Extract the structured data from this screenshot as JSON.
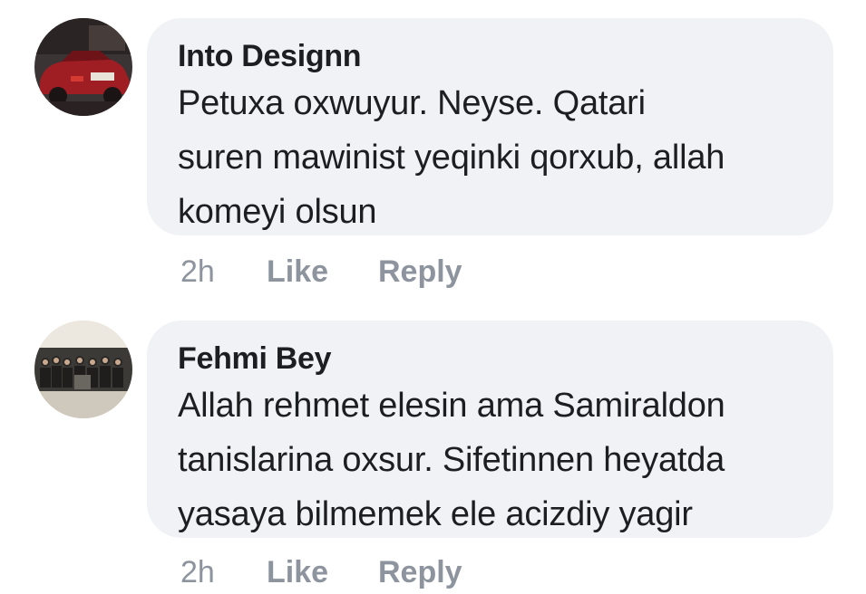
{
  "comments": [
    {
      "author": "Into Designn",
      "text": "Petuxa oxwuyur. Neyse. Qatari suren mawinist yeqinki qorxub, allah komeyi olsun",
      "text_lines": [
        "Petuxa oxwuyur. Neyse. Qatari",
        "suren mawinist yeqinki qorxub, allah",
        "komeyi olsun"
      ],
      "time": "2h",
      "like_label": "Like",
      "reply_label": "Reply",
      "avatar_icon": "profile-photo-car"
    },
    {
      "author": "Fehmi Bey",
      "text": "Allah rehmet elesin ama Samiraldon tanislarina oxsur. Sifetinnen heyatda yasaya bilmemek ele acizdiy yagir",
      "text_lines": [
        "Allah rehmet elesin ama Samiraldon",
        "tanislarina oxsur. Sifetinnen heyatda",
        "yasaya bilmemek ele acizdiy yagir"
      ],
      "time": "2h",
      "like_label": "Like",
      "reply_label": "Reply",
      "avatar_icon": "profile-photo-group"
    }
  ],
  "colors": {
    "bubble_bg": "#f0f2f5",
    "text": "#1c1e21",
    "meta": "#8d949e"
  }
}
